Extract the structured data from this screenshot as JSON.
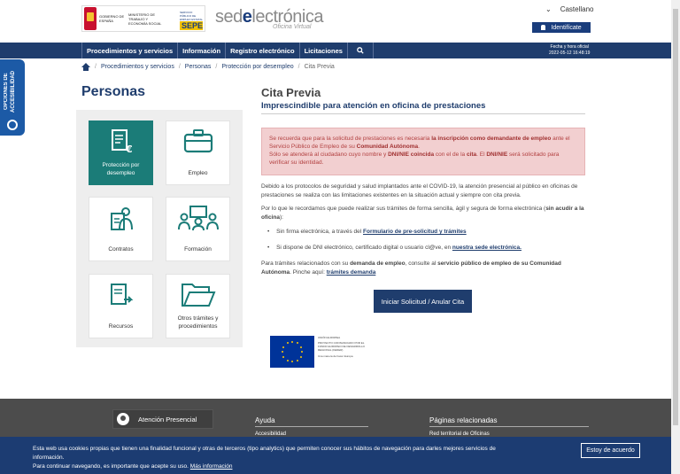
{
  "header": {
    "gov_text": "GOBIERNO DE ESPAÑA",
    "ministry_text": "MINISTERIO DE TRABAJO Y ECONOMÍA SOCIAL",
    "sepe_small": "SERVICIO PÚBLICO DE EMPLEO ESTATAL",
    "sepe_label": "SEPE",
    "sede_prefix": "sed",
    "sede_e": "e",
    "sede_suffix": "lectrónica",
    "sede_sub": "Oficina Virtual",
    "language": "Castellano",
    "identify_label": "Identifícate"
  },
  "nav": {
    "items": [
      "Procedimientos y servicios",
      "Información",
      "Registro electrónico",
      "Licitaciones"
    ],
    "date_label": "Fecha y hora oficial",
    "date_value": "2022-05-12   16:48:19"
  },
  "breadcrumb": {
    "items": [
      "Procedimientos y servicios",
      "Personas",
      "Protección por desempleo"
    ],
    "current": "Cita Previa"
  },
  "accessibility": {
    "label": "OPCIONES DE ACCESIBILIDAD"
  },
  "sidebar": {
    "title": "Personas",
    "tiles": [
      {
        "label": "Protección por desempleo",
        "icon": "document-euro-icon"
      },
      {
        "label": "Empleo",
        "icon": "briefcase-icon"
      },
      {
        "label": "Contratos",
        "icon": "contract-icon"
      },
      {
        "label": "Formación",
        "icon": "training-icon"
      },
      {
        "label": "Recursos",
        "icon": "resources-icon"
      },
      {
        "label": "Otros trámites y procedimientos",
        "icon": "folder-icon"
      }
    ]
  },
  "main": {
    "title": "Cita Previa",
    "subtitle": "Imprescindible para atención en oficina de prestaciones",
    "alert": {
      "t1": "Se recuerda que para la solicitud de prestaciones es necesaria ",
      "b1": "la inscripción como demandante de empleo",
      "t2": " ante el Servicio Público de Empleo de su ",
      "b2": "Comunidad Autónoma",
      "t3": ".",
      "t4": "Sólo se atenderá al ciudadano cuyo nombre y ",
      "b3": "DNI/NIE coincida",
      "t5": " con el de la ",
      "b4": "cita",
      "t6": ". El ",
      "b5": "DNI/NIE",
      "t7": " será solicitado para verificar su identidad."
    },
    "p1": "Debido a los protocolos de seguridad y salud implantados ante el COVID-19, la atención presencial al público en oficinas de prestaciones se realiza con las limitaciones existentes en la situación actual y siempre con cita previa.",
    "p2_text": "Por lo que le recordamos que puede realizar sus trámites de forma sencilla, ágil y segura de forma electrónica (",
    "p2_bold": "sin acudir a la oficina",
    "p2_end": "):",
    "bullet1_text": "Sin firma electrónica, a través del ",
    "bullet1_link": "Formulario de pre-solicitud y trámites",
    "bullet2_text": "Si dispone de DNI electrónico, certificado digital o usuario cl@ve, en ",
    "bullet2_link": "nuestra sede electrónica.",
    "p3_t1": "Para trámites relacionados con su ",
    "p3_b1": "demanda de empleo",
    "p3_t2": ", consulte al ",
    "p3_b2": "servicio público de empleo de su Comunidad Autónoma",
    "p3_t3": ". Pinche aquí: ",
    "p3_link": "trámites demanda",
    "button": "Iniciar Solicitud / Anular Cita",
    "eu_text": "UNIÓN EUROPEA",
    "eu_sub": "PROYECTO COFINANCIADO POR EL FONDO EUROPEO DE DESARROLLO REGIONAL (FEDER)",
    "eu_motto": "Una manera de hacer Europa"
  },
  "footer": {
    "attention": "Atención Presencial",
    "col1_title": "Ayuda",
    "col1_item": "Accesibilidad",
    "col2_title": "Páginas relacionadas",
    "col2_item": "Red territorial de Oficinas"
  },
  "cookie": {
    "text1": "Esta web usa cookies propias que tienen una finalidad funcional y otras de terceros (tipo analytics) que permiten conocer sus hábitos de navegación para darles mejores servicios de información.",
    "text2": "Para continuar navegando, es importante que acepte su uso. ",
    "link": "Más información",
    "button": "Estoy de acuerdo"
  }
}
